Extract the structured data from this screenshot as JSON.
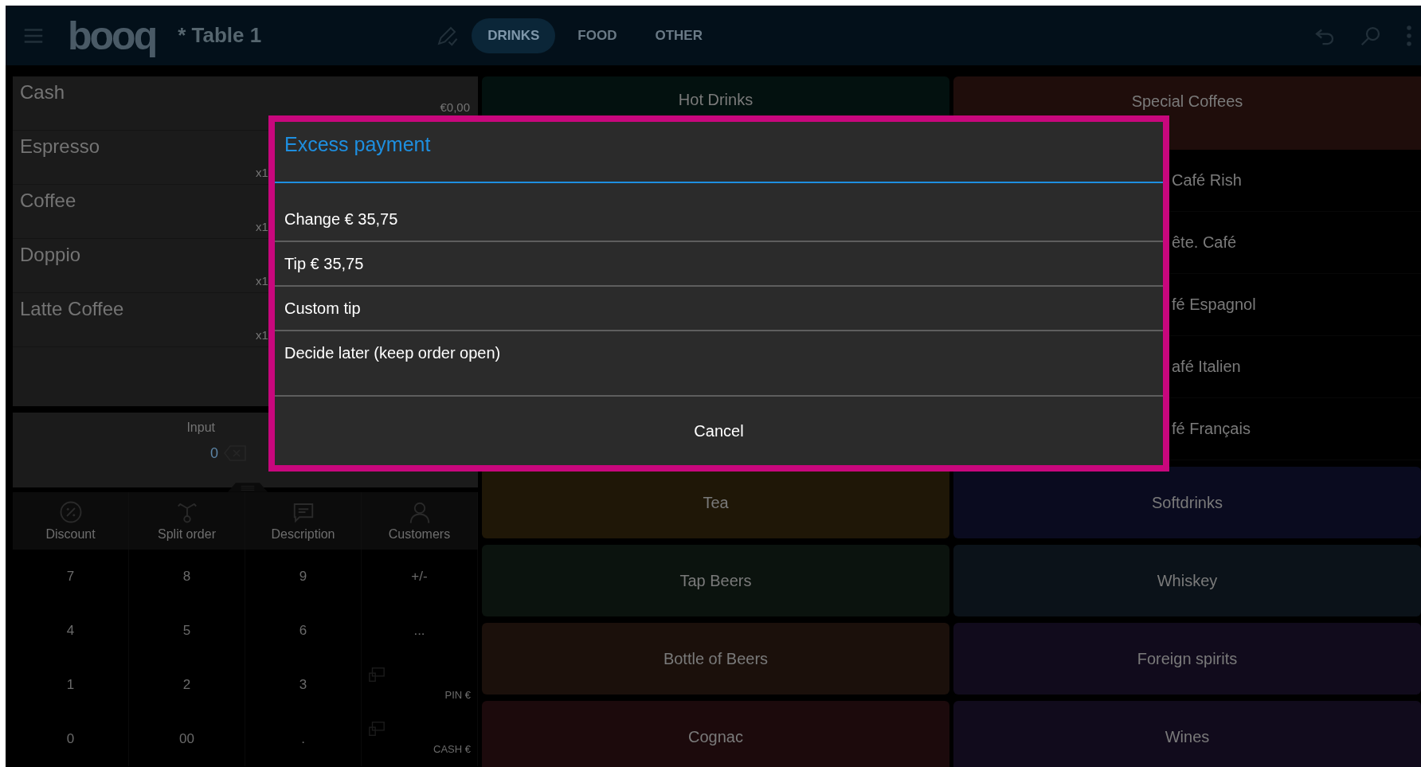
{
  "top_bar": {
    "logo": "booq",
    "title": "* Table 1",
    "tabs": [
      {
        "label": "DRINKS",
        "selected": true
      },
      {
        "label": "FOOD",
        "selected": false
      },
      {
        "label": "OTHER",
        "selected": false
      }
    ]
  },
  "order": {
    "lines": [
      {
        "name": "Cash",
        "amount": "€0,00"
      },
      {
        "name": "Espresso",
        "quantity": "x1"
      },
      {
        "name": "Coffee",
        "quantity": "x1"
      },
      {
        "name": "Doppio",
        "quantity": "x1"
      },
      {
        "name": "Latte Coffee",
        "quantity": "x1"
      }
    ]
  },
  "input": {
    "label": "Input",
    "value": "0"
  },
  "actions": [
    {
      "kind": "discount",
      "label": "Discount"
    },
    {
      "kind": "split",
      "label": "Split order"
    },
    {
      "kind": "description",
      "label": "Description"
    },
    {
      "kind": "customers",
      "label": "Customers"
    }
  ],
  "keypad": [
    {
      "kind": "key",
      "label": "7"
    },
    {
      "kind": "key",
      "label": "8"
    },
    {
      "kind": "key",
      "label": "9"
    },
    {
      "kind": "key",
      "label": "+/-"
    },
    {
      "kind": "key",
      "label": "4"
    },
    {
      "kind": "key",
      "label": "5"
    },
    {
      "kind": "key",
      "label": "6"
    },
    {
      "kind": "key",
      "label": "..."
    },
    {
      "kind": "key",
      "label": "1"
    },
    {
      "kind": "key",
      "label": "2"
    },
    {
      "kind": "key",
      "label": "3"
    },
    {
      "kind": "payment",
      "label": "PIN €"
    },
    {
      "kind": "key",
      "label": "0"
    },
    {
      "kind": "key",
      "label": "00"
    },
    {
      "kind": "key",
      "label": "."
    },
    {
      "kind": "payment",
      "label": "CASH €"
    }
  ],
  "categories": {
    "hot": {
      "label": "Hot Drinks",
      "color": "#03110f"
    },
    "special": {
      "label": "Special Coffees",
      "color": "#1f0d0b",
      "items": [
        "Café Rish",
        "ête. Café",
        "fé Espagnol",
        "afé Italien",
        "fé Français"
      ]
    },
    "tiles": [
      {
        "label": "Tea",
        "color": "#1f1707"
      },
      {
        "label": "Softdrinks",
        "color": "#0a0b1f"
      },
      {
        "label": "Tap Beers",
        "color": "#0b130e"
      },
      {
        "label": "Whiskey",
        "color": "#0b1219"
      },
      {
        "label": "Bottle of Beers",
        "color": "#1b100b"
      },
      {
        "label": "Foreign spirits",
        "color": "#110b1c"
      },
      {
        "label": "Cognac",
        "color": "#1c0a0c"
      },
      {
        "label": "Wines",
        "color": "#110b1c"
      }
    ]
  },
  "dialog": {
    "title": "Excess payment",
    "options": [
      "Change € 35,75",
      "Tip € 35,75",
      "Custom tip",
      "Decide later (keep order open)"
    ],
    "cancel": "Cancel"
  }
}
